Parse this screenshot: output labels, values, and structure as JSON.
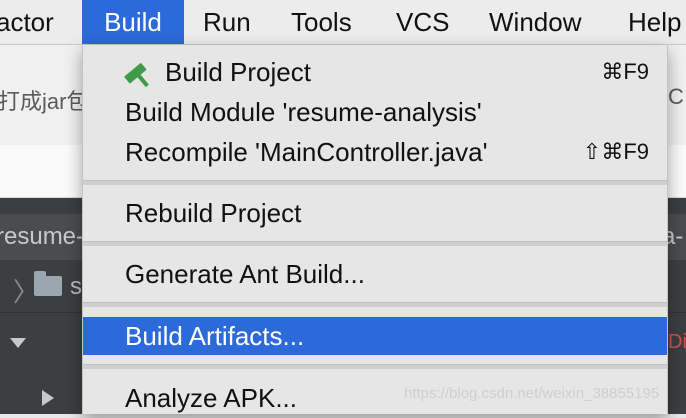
{
  "menubar": {
    "items": [
      {
        "label": "actor",
        "active": false
      },
      {
        "label": "Build",
        "active": true
      },
      {
        "label": "Run",
        "active": false
      },
      {
        "label": "Tools",
        "active": false
      },
      {
        "label": "VCS",
        "active": false
      },
      {
        "label": "Window",
        "active": false
      },
      {
        "label": "Help",
        "active": false
      }
    ]
  },
  "background": {
    "toolbar_text_left": "打成jar包",
    "toolbar_text_right": "C",
    "tab_left": "resume-",
    "tab_right": "a-",
    "nav_text": "s",
    "side_label": "Di"
  },
  "build_menu": {
    "items": [
      {
        "label": "Build Project",
        "shortcut": "⌘F9",
        "icon": "hammer-icon"
      },
      {
        "label": "Build Module 'resume-analysis'",
        "shortcut": ""
      },
      {
        "label": "Recompile 'MainController.java'",
        "shortcut": "⇧⌘F9"
      },
      {
        "label": "Rebuild Project",
        "shortcut": ""
      },
      {
        "label": "Generate Ant Build...",
        "shortcut": ""
      },
      {
        "label": "Build Artifacts...",
        "shortcut": "",
        "highlighted": true
      },
      {
        "label": "Analyze APK...",
        "shortcut": ""
      }
    ]
  },
  "watermark": "https://blog.csdn.net/weixin_38855195",
  "colors": {
    "accent": "#2c6ad9",
    "menu_bg": "#e6e6e6",
    "ide_dark": "#3c3f41",
    "hammer_green": "#3f9b4a"
  }
}
